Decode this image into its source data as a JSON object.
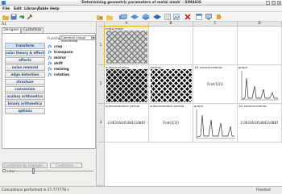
{
  "window": {
    "title": "'Determining geometric parameters of metal mesh' - SIMAGIS"
  },
  "menu": [
    "File",
    "Edit",
    "Library",
    "Table",
    "Help"
  ],
  "toolbar": {
    "icons": [
      "open-icon",
      "save-icon",
      "redo-icon",
      "tool-icon",
      "open-images-icon",
      "folder-icon",
      "image-stack-icon",
      "layers-icon",
      "film-icon",
      "blue-box-icon",
      "grid-icon",
      "image-icon",
      "delete-icon",
      "table-icon",
      "monitor-icon",
      "tag-icon"
    ]
  },
  "left": {
    "cell_ref": "A1",
    "tabs": [
      "Designer",
      "Customize"
    ],
    "functions_label": "Functions of:",
    "functions_value": "Common image processing",
    "categories": [
      "transform",
      "color theory & effects",
      "effects",
      "noise removal",
      "edge detection",
      "structure",
      "conversion",
      "scalary arithmetics",
      "binary arithmetics",
      "options"
    ],
    "functions": [
      "crop",
      "transpose",
      "mirror",
      "shift",
      "resizing",
      "rotation"
    ],
    "customize_button": "Customize by example...",
    "customize_button2": "Customize...",
    "view_label": "view"
  },
  "sheet": {
    "columns": [
      "A",
      "B",
      "C",
      "D"
    ],
    "rows": [
      "1",
      "2",
      "3"
    ],
    "cells": {
      "A1": "metal mesh",
      "A2": "autocorrelation",
      "B2": "closing",
      "C2": "1D autocorrelation",
      "C2_val": "Find(1[2])",
      "D2": "graph",
      "A3": "autocorrelation period",
      "A3_val": "2.06336345384110887",
      "B3": "autocorrelation period",
      "B3_val": "Find(1[3])",
      "C3": "graph",
      "D3": "1D autocorrelation",
      "D3_val": "2.06336345384110887"
    }
  },
  "status": {
    "left": "Calculations performed in 27.777778 s",
    "right": "Finished"
  }
}
